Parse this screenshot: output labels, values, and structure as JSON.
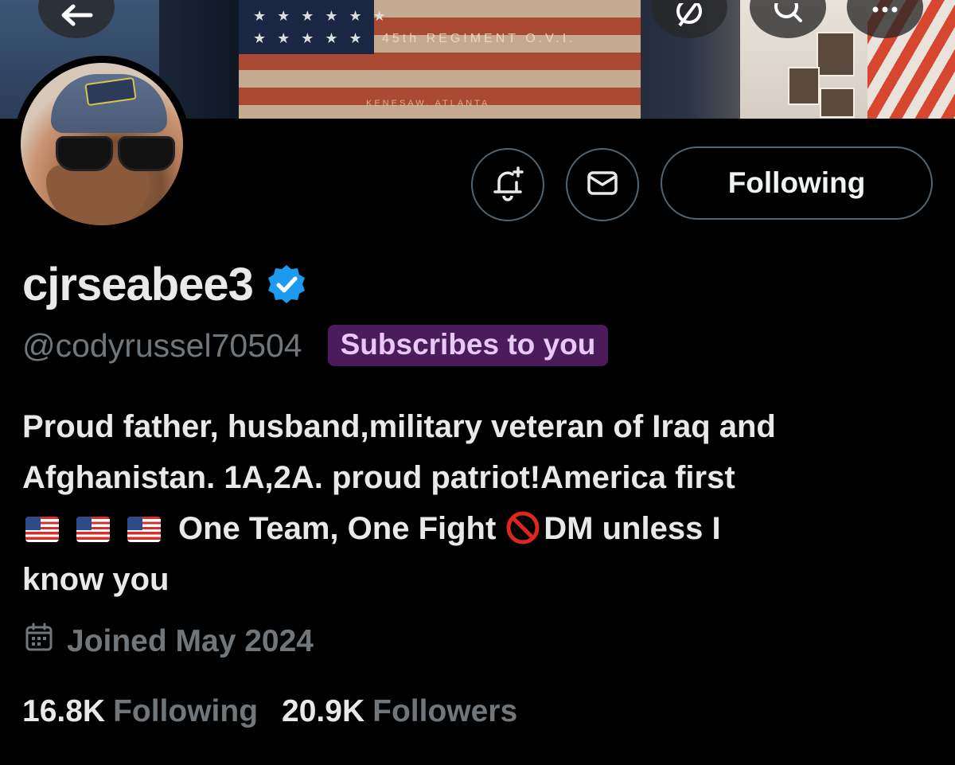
{
  "banner": {
    "flag_text": "45th REGIMENT O.V.I.",
    "flag_subtext": "KENESAW. ATLANTA"
  },
  "top_bar": {
    "back_icon": "arrow-left-icon",
    "grok_icon": "grok-icon",
    "search_icon": "search-icon",
    "more_icon": "more-icon"
  },
  "actions": {
    "notify_icon": "bell-plus-icon",
    "message_icon": "envelope-icon",
    "follow_label": "Following"
  },
  "profile": {
    "display_name": "cjrseabee3",
    "verified_icon": "verified-badge-icon",
    "verified_color": "#1d9bf0",
    "handle": "@codyrussel70504",
    "subscribes_badge": "Subscribes to you",
    "bio_line1": "Proud father, husband,military veteran of Iraq and",
    "bio_line2": "Afghanistan. 1A,2A. proud patriot!America first",
    "bio_line3_text_a": "One Team, One Fight",
    "bio_line3_text_b": "DM unless I",
    "bio_line4": "know you",
    "bio_emoji_flags": [
      "us-flag-icon",
      "us-flag-icon",
      "us-flag-icon"
    ],
    "bio_emoji_prohibited": "prohibited-icon",
    "joined_icon": "calendar-icon",
    "joined_text": "Joined May 2024"
  },
  "stats": {
    "following_count": "16.8K",
    "following_label": "Following",
    "followers_count": "20.9K",
    "followers_label": "Followers"
  }
}
